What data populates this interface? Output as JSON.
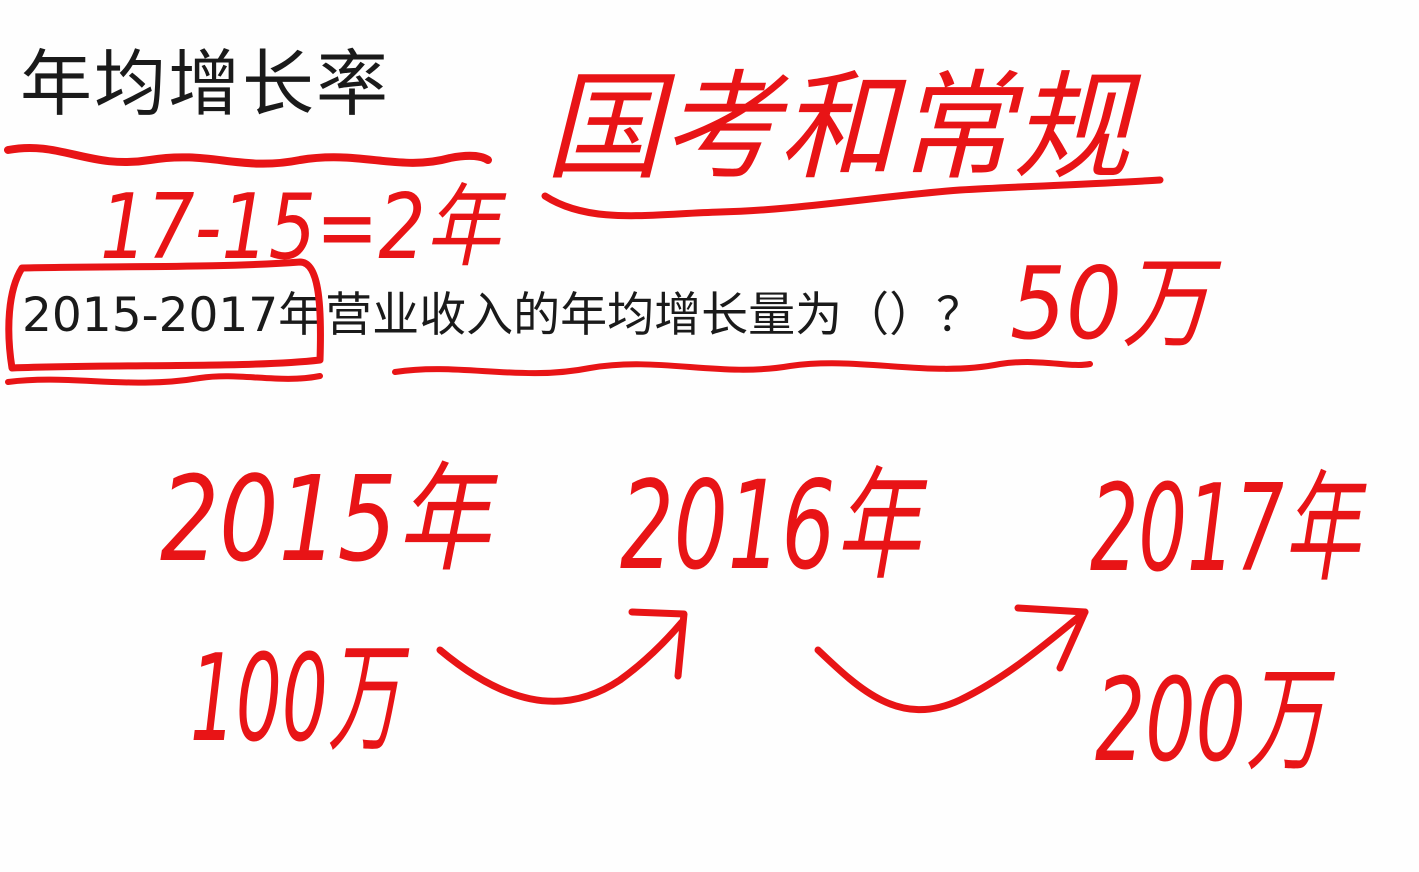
{
  "slide": {
    "title": "年均增长率",
    "question": "2015-2017年营业收入的年均增长量为（）？"
  },
  "annotations": {
    "exam_type": "国考和常规",
    "years_calc": "17-15=2年",
    "answer": "50万",
    "timeline": [
      {
        "year": "2015年",
        "value": "100万"
      },
      {
        "year": "2016年",
        "value": ""
      },
      {
        "year": "2017年",
        "value": "200万"
      }
    ]
  },
  "colors": {
    "ink": "#e81416",
    "text": "#1a1a1a",
    "background": "#fefefe"
  }
}
